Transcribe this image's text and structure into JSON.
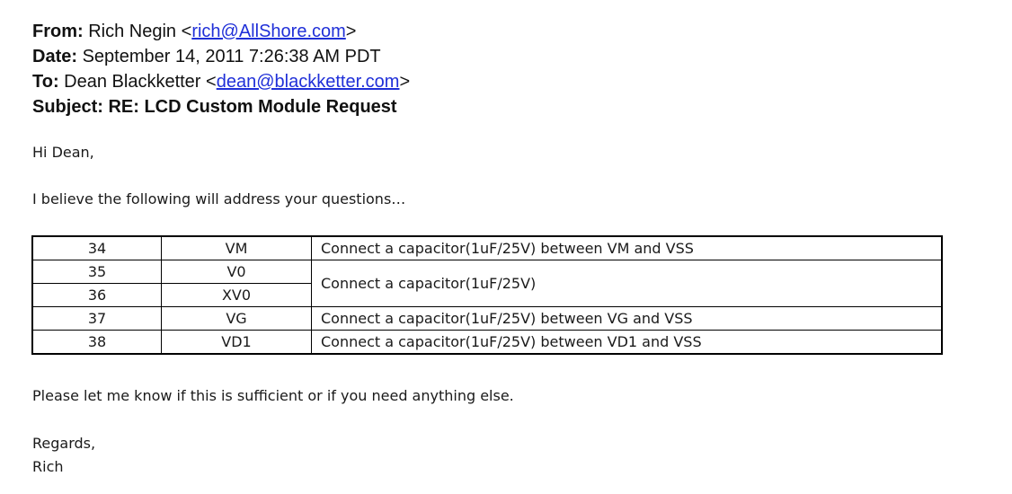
{
  "header": {
    "from_label": "From:",
    "from_name": "Rich Negin",
    "from_email": "rich@AllShore.com",
    "date_label": "Date:",
    "date_value": "September 14, 2011 7:26:38 AM PDT",
    "to_label": "To:",
    "to_name": "Dean Blackketter",
    "to_email": "dean@blackketter.com",
    "subject_label": "Subject:",
    "subject_value": "RE: LCD Custom Module Request"
  },
  "body": {
    "greeting": "Hi Dean,",
    "intro": "I believe the following will address your questions…",
    "closing": "Please let me know if this is sufficient or if you need anything else.",
    "signoff": "Regards,",
    "signature": "Rich"
  },
  "table": {
    "rows": [
      {
        "pin": "34",
        "name": "VM",
        "desc": "Connect a capacitor(1uF/25V) between VM and VSS"
      },
      {
        "pin": "35",
        "name": "V0",
        "desc": "Connect a capacitor(1uF/25V)"
      },
      {
        "pin": "36",
        "name": "XV0"
      },
      {
        "pin": "37",
        "name": "VG",
        "desc": "Connect a capacitor(1uF/25V) between VG and VSS"
      },
      {
        "pin": "38",
        "name": "VD1",
        "desc": "Connect a capacitor(1uF/25V) between VD1 and VSS"
      }
    ]
  },
  "colors": {
    "link": "#1f2fd8",
    "text": "#111111",
    "border": "#000000"
  }
}
